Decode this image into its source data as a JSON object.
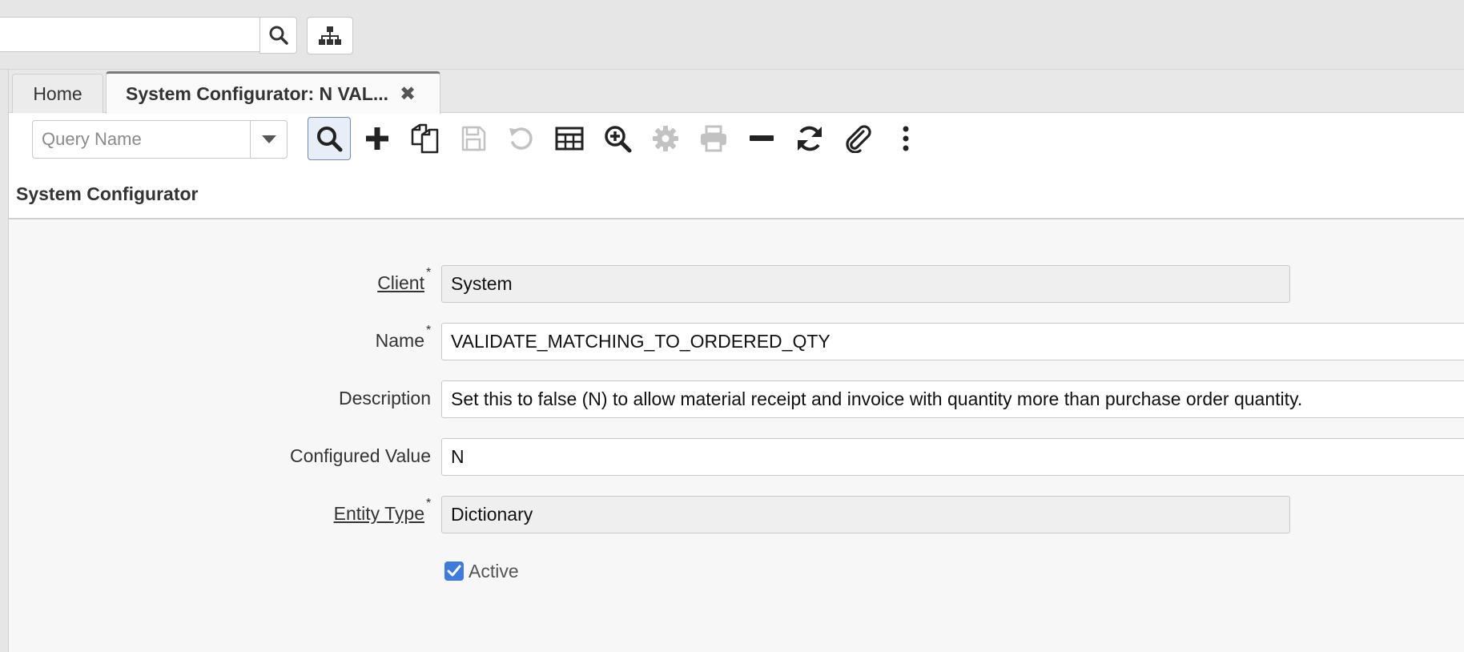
{
  "topbar": {
    "search_value": "",
    "search_icon": "search-icon",
    "tree_icon": "sitemap-icon"
  },
  "tabs": [
    {
      "label": "Home"
    },
    {
      "label": "System Configurator: N VAL...",
      "close_glyph": "✖"
    }
  ],
  "toolbar": {
    "query_placeholder": "Query Name",
    "buttons": [
      {
        "name": "search-icon",
        "enabled": true,
        "active": true
      },
      {
        "name": "plus-icon",
        "enabled": true
      },
      {
        "name": "copy-icon",
        "enabled": true
      },
      {
        "name": "save-icon",
        "enabled": false
      },
      {
        "name": "undo-icon",
        "enabled": false
      },
      {
        "name": "grid-icon",
        "enabled": true
      },
      {
        "name": "zoom-icon",
        "enabled": true
      },
      {
        "name": "gear-icon",
        "enabled": false
      },
      {
        "name": "print-icon",
        "enabled": false
      },
      {
        "name": "minus-icon",
        "enabled": true
      },
      {
        "name": "refresh-icon",
        "enabled": true
      },
      {
        "name": "paperclip-icon",
        "enabled": true
      },
      {
        "name": "more-icon",
        "enabled": true
      }
    ]
  },
  "section": {
    "title": "System Configurator"
  },
  "form": {
    "client": {
      "label": "Client",
      "value": "System",
      "mandatory": "*"
    },
    "name": {
      "label": "Name",
      "value": "VALIDATE_MATCHING_TO_ORDERED_QTY",
      "mandatory": "*"
    },
    "description": {
      "label": "Description",
      "value": "Set this to false (N) to allow material receipt and invoice with quantity more than purchase order quantity."
    },
    "configured_value": {
      "label": "Configured Value",
      "value": "N"
    },
    "entity_type": {
      "label": "Entity Type",
      "value": "Dictionary",
      "mandatory": "*"
    },
    "active": {
      "label": "Active",
      "checked": true
    }
  },
  "colors": {
    "accent": "#3d7be0",
    "icon_enabled": "#333333",
    "icon_disabled": "#c2c2c2"
  }
}
